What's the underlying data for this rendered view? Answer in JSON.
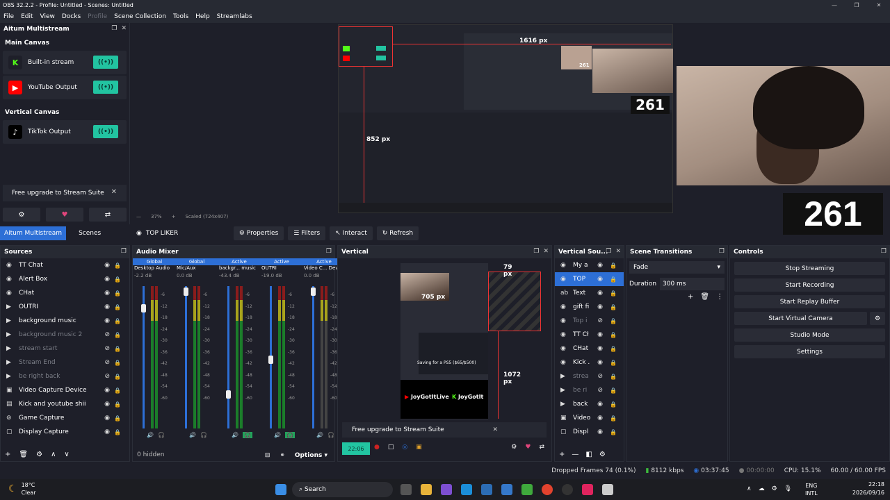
{
  "window": {
    "title": "OBS 32.2.2 - Profile: Untitled - Scenes: Untitled"
  },
  "menu": [
    "File",
    "Edit",
    "View",
    "Docks",
    "Profile",
    "Scene Collection",
    "Tools",
    "Help",
    "Streamlabs"
  ],
  "ams": {
    "title": "Aitum Multistream",
    "main_canvas": "Main Canvas",
    "vertical_canvas": "Vertical Canvas",
    "outputs_main": [
      {
        "label": "Built-in stream",
        "logo": "K",
        "color": "#1e1f29"
      },
      {
        "label": "YouTube Output",
        "logo": "▶",
        "color": "#ff0000"
      }
    ],
    "outputs_vertical": [
      {
        "label": "TikTok Output",
        "logo": "♪",
        "color": "#000000"
      }
    ],
    "upgrade": "Free upgrade to Stream Suite",
    "close": "✕"
  },
  "preview": {
    "px_1616": "1616 px",
    "px_852": "852 px",
    "counter_small": "261",
    "counter_mid": "261",
    "counter_big": "261",
    "zoom": "37%",
    "scaled": "Scaled (724x407)"
  },
  "tabs": [
    "Aitum Multistream",
    "Scenes"
  ],
  "source_toolbar": {
    "current": "TOP LIKER",
    "properties": "Properties",
    "filters": "Filters",
    "interact": "Interact",
    "refresh": "Refresh"
  },
  "sources": {
    "title": "Sources",
    "items": [
      {
        "label": "TT Chat",
        "icon": "◉",
        "dim": false
      },
      {
        "label": "Alert Box",
        "icon": "◉",
        "dim": false
      },
      {
        "label": "CHat",
        "icon": "◉",
        "dim": false
      },
      {
        "label": "OUTRI",
        "icon": "▶",
        "dim": false
      },
      {
        "label": "background music",
        "icon": "▶",
        "dim": false
      },
      {
        "label": "background music 2",
        "icon": "▶",
        "dim": true
      },
      {
        "label": "stream start",
        "icon": "▶",
        "dim": true
      },
      {
        "label": "Stream End",
        "icon": "▶",
        "dim": true
      },
      {
        "label": "be right back",
        "icon": "▶",
        "dim": true
      },
      {
        "label": "Video Capture Device",
        "icon": "▣",
        "dim": false
      },
      {
        "label": "Kick and youtube shii",
        "icon": "▤",
        "dim": false
      },
      {
        "label": "Game Capture",
        "icon": "⊚",
        "dim": false
      },
      {
        "label": "Display Capture",
        "icon": "▢",
        "dim": false
      }
    ]
  },
  "mixer": {
    "title": "Audio Mixer",
    "hidden": "0 hidden",
    "options": "Options",
    "channels": [
      {
        "tag": "Global",
        "name": "Desktop Audio",
        "db": "-2.2 dB"
      },
      {
        "tag": "Global",
        "name": "Mic/Aux",
        "db": "0.0 dB"
      },
      {
        "tag": "Active",
        "name": "backgr... music",
        "db": "-43.4 dB"
      },
      {
        "tag": "Active",
        "name": "OUTRI",
        "db": "-19.0 dB"
      },
      {
        "tag": "Active",
        "name": "Video C... Devi",
        "db": "0.0 dB"
      }
    ],
    "ticks": [
      "0",
      "-6",
      "-12",
      "-18",
      "-24",
      "-30",
      "-36",
      "-42",
      "-48",
      "-54",
      "-60"
    ]
  },
  "vertical": {
    "title": "Vertical",
    "px_79": "79 px",
    "px_705": "705 px",
    "px_1072": "1072 px",
    "brand_left": "JoyGotItLive",
    "brand_right": "JoyGotIt",
    "goal_text": "Saving for a PS5 ($65/$500)",
    "upgrade": "Free upgrade to Stream Suite",
    "time": "22:06"
  },
  "vertical_sources": {
    "title": "Vertical Sou...",
    "items": [
      {
        "label": "My a",
        "icon": "◉",
        "dim": false,
        "sel": false
      },
      {
        "label": "TOP",
        "icon": "◉",
        "dim": false,
        "sel": true
      },
      {
        "label": "Text",
        "icon": "ab",
        "dim": false,
        "sel": false
      },
      {
        "label": "gift fi",
        "icon": "◉",
        "dim": false,
        "sel": false
      },
      {
        "label": "Top i",
        "icon": "◉",
        "dim": true,
        "sel": false
      },
      {
        "label": "TT Cł",
        "icon": "◉",
        "dim": false,
        "sel": false
      },
      {
        "label": "CHat",
        "icon": "◉",
        "dim": false,
        "sel": false
      },
      {
        "label": "Kick .",
        "icon": "◉",
        "dim": false,
        "sel": false
      },
      {
        "label": "strea",
        "icon": "▶",
        "dim": true,
        "sel": false
      },
      {
        "label": "be ri",
        "icon": "▶",
        "dim": true,
        "sel": false
      },
      {
        "label": "back",
        "icon": "▶",
        "dim": false,
        "sel": false
      },
      {
        "label": "Video",
        "icon": "▣",
        "dim": false,
        "sel": false
      },
      {
        "label": "Displ",
        "icon": "▢",
        "dim": false,
        "sel": false
      }
    ]
  },
  "transitions": {
    "title": "Scene Transitions",
    "selected": "Fade",
    "duration_label": "Duration",
    "duration": "300 ms"
  },
  "controls": {
    "title": "Controls",
    "buttons": [
      "Stop Streaming",
      "Start Recording",
      "Start Replay Buffer",
      "Start Virtual Camera",
      "Studio Mode",
      "Settings"
    ]
  },
  "status": {
    "dropped": "Dropped Frames 74 (0.1%)",
    "bitrate": "8112 kbps",
    "stream_time": "03:37:45",
    "rec_time": "00:00:00",
    "cpu": "CPU: 15.1%",
    "fps": "60.00 / 60.00 FPS"
  },
  "taskbar": {
    "temp": "18°C",
    "weather": "Clear",
    "search": "Search",
    "lang1": "ENG",
    "lang2": "INTL",
    "time": "22:18",
    "date": "2026/09/16"
  }
}
